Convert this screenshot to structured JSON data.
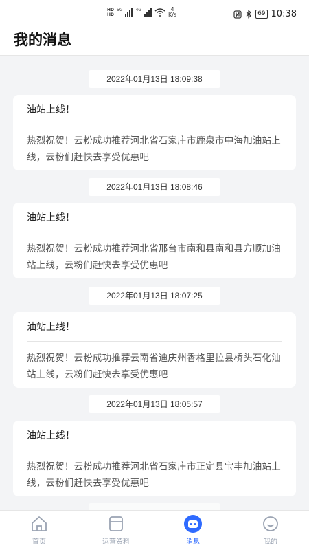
{
  "status_bar": {
    "hd1": "HD",
    "hd2": "HD",
    "net1": "5G",
    "net2": "4G",
    "speed_value": "4",
    "speed_unit": "K/s",
    "battery": "69",
    "time": "10:38",
    "icons": [
      "nfc-icon",
      "bluetooth-icon",
      "battery-icon",
      "wifi-icon",
      "signal-icon"
    ]
  },
  "header": {
    "title": "我的消息"
  },
  "messages": [
    {
      "timestamp": "2022年01月13日  18:09:38",
      "title": "油站上线！",
      "body": "热烈祝贺！云粉成功推荐河北省石家庄市鹿泉市中海加油站上线，云粉们赶快去享受优惠吧"
    },
    {
      "timestamp": "2022年01月13日  18:08:46",
      "title": "油站上线！",
      "body": "热烈祝贺！云粉成功推荐河北省邢台市南和县南和县方顺加油站上线，云粉们赶快去享受优惠吧"
    },
    {
      "timestamp": "2022年01月13日  18:07:25",
      "title": "油站上线！",
      "body": "热烈祝贺！云粉成功推荐云南省迪庆州香格里拉县桥头石化油站上线，云粉们赶快去享受优惠吧"
    },
    {
      "timestamp": "2022年01月13日  18:05:57",
      "title": "油站上线！",
      "body": "热烈祝贺！云粉成功推荐河北省石家庄市正定县宝丰加油站上线，云粉们赶快去享受优惠吧"
    }
  ],
  "tabs": [
    {
      "label": "首页",
      "icon": "home-icon",
      "active": false
    },
    {
      "label": "运营资料",
      "icon": "document-icon",
      "active": false
    },
    {
      "label": "消息",
      "icon": "message-icon",
      "active": true
    },
    {
      "label": "我的",
      "icon": "profile-icon",
      "active": false
    }
  ],
  "colors": {
    "accent": "#2f6bff",
    "inactive_tab": "#9aa3b2",
    "background": "#f3f4f6"
  }
}
